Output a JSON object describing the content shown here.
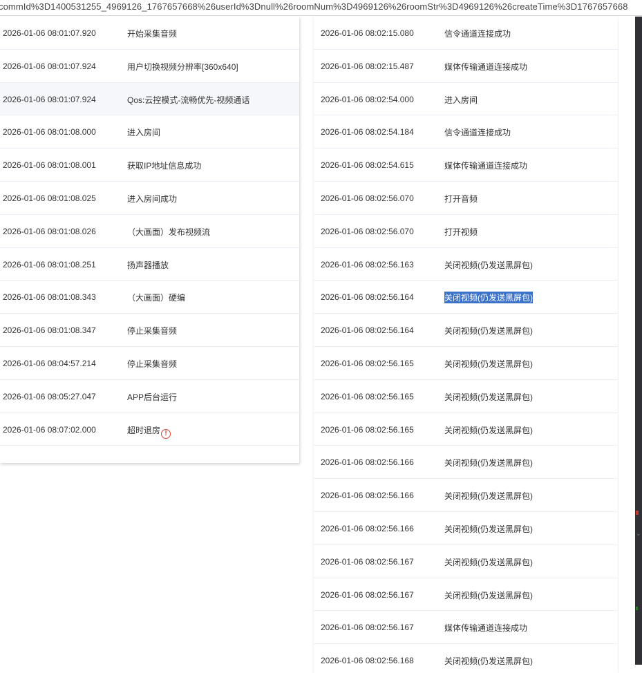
{
  "url_bar": {
    "text": "commId%3D1400531255_4969126_1767657668%26userId%3Dnull%26roomNum%3D4969126%26roomStr%3D4969126%26createTime%3D1767657668"
  },
  "left_log": [
    {
      "time": "2026-01-06 08:01:07.920",
      "message": "开始采集音频"
    },
    {
      "time": "2026-01-06 08:01:07.924",
      "message": "用户切换视频分辨率[360x640]"
    },
    {
      "time": "2026-01-06 08:01:07.924",
      "message": "Qos:云控模式-流畅优先-视频通话"
    },
    {
      "time": "2026-01-06 08:01:08.000",
      "message": "进入房间"
    },
    {
      "time": "2026-01-06 08:01:08.001",
      "message": "获取IP地址信息成功"
    },
    {
      "time": "2026-01-06 08:01:08.025",
      "message": "进入房间成功"
    },
    {
      "time": "2026-01-06 08:01:08.026",
      "message": "（大画面）发布视频流"
    },
    {
      "time": "2026-01-06 08:01:08.251",
      "message": "扬声器播放"
    },
    {
      "time": "2026-01-06 08:01:08.343",
      "message": "（大画面）硬编"
    },
    {
      "time": "2026-01-06 08:01:08.347",
      "message": "停止采集音频"
    },
    {
      "time": "2026-01-06 08:04:57.214",
      "message": "停止采集音频"
    },
    {
      "time": "2026-01-06 08:05:27.047",
      "message": "APP后台运行"
    },
    {
      "time": "2026-01-06 08:07:02.000",
      "message": "超时退房"
    }
  ],
  "right_log": [
    {
      "time": "2026-01-06 08:02:15.080",
      "message": "信令通道连接成功"
    },
    {
      "time": "2026-01-06 08:02:15.487",
      "message": "媒体传输通道连接成功"
    },
    {
      "time": "2026-01-06 08:02:54.000",
      "message": "进入房间"
    },
    {
      "time": "2026-01-06 08:02:54.184",
      "message": "信令通道连接成功"
    },
    {
      "time": "2026-01-06 08:02:54.615",
      "message": "媒体传输通道连接成功"
    },
    {
      "time": "2026-01-06 08:02:56.070",
      "message": "打开音频"
    },
    {
      "time": "2026-01-06 08:02:56.070",
      "message": "打开视频"
    },
    {
      "time": "2026-01-06 08:02:56.163",
      "message": "关闭视频(仍发送黑屏包)"
    },
    {
      "time": "2026-01-06 08:02:56.164",
      "message": "关闭视频(仍发送黑屏包)"
    },
    {
      "time": "2026-01-06 08:02:56.164",
      "message": "关闭视频(仍发送黑屏包)"
    },
    {
      "time": "2026-01-06 08:02:56.165",
      "message": "关闭视频(仍发送黑屏包)"
    },
    {
      "time": "2026-01-06 08:02:56.165",
      "message": "关闭视频(仍发送黑屏包)"
    },
    {
      "time": "2026-01-06 08:02:56.165",
      "message": "关闭视频(仍发送黑屏包)"
    },
    {
      "time": "2026-01-06 08:02:56.166",
      "message": "关闭视频(仍发送黑屏包)"
    },
    {
      "time": "2026-01-06 08:02:56.166",
      "message": "关闭视频(仍发送黑屏包)"
    },
    {
      "time": "2026-01-06 08:02:56.166",
      "message": "关闭视频(仍发送黑屏包)"
    },
    {
      "time": "2026-01-06 08:02:56.167",
      "message": "关闭视频(仍发送黑屏包)"
    },
    {
      "time": "2026-01-06 08:02:56.167",
      "message": "关闭视频(仍发送黑屏包)"
    },
    {
      "time": "2026-01-06 08:02:56.167",
      "message": "媒体传输通道连接成功"
    },
    {
      "time": "2026-01-06 08:02:56.168",
      "message": "关闭视频(仍发送黑屏包)"
    }
  ],
  "warning_icon": "exclamation-circle-icon",
  "colors": {
    "selection": "#3c73c9",
    "warning": "#e8402e",
    "row_divider": "#ebeef5",
    "hover_row": "#f5f7fa"
  }
}
